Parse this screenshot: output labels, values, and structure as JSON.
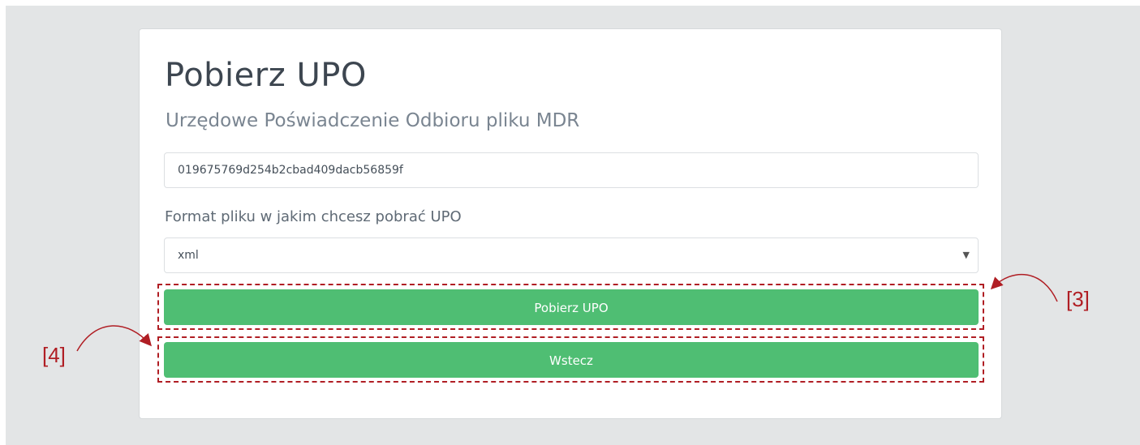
{
  "page": {
    "title": "Pobierz UPO",
    "subtitle": "Urzędowe Poświadczenie Odbioru pliku MDR"
  },
  "form": {
    "id_value": "019675769d254b2cbad409dacb56859f",
    "format_label": "Format pliku w jakim chcesz pobrać UPO",
    "format_selected": "xml",
    "download_button": "Pobierz UPO",
    "back_button": "Wstecz"
  },
  "annotations": {
    "callout_download": "[3]",
    "callout_back": "[4]",
    "color": "#b01e24"
  },
  "colors": {
    "button": "#4fbe73",
    "background": "#e3e5e6"
  }
}
